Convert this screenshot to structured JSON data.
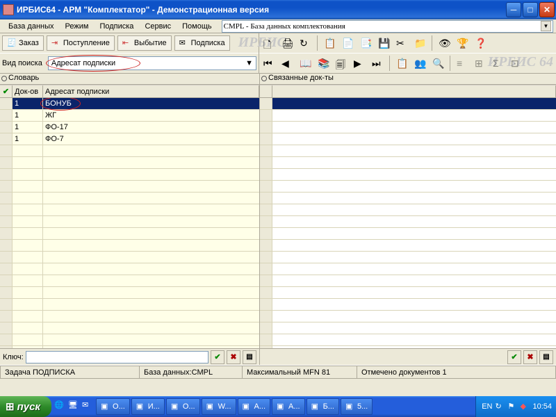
{
  "window": {
    "title": "ИРБИС64 - АРМ \"Комплектатор\" - Демонстрационная версия"
  },
  "menu": {
    "items": [
      "База данных",
      "Режим",
      "Подписка",
      "Сервис",
      "Помощь"
    ]
  },
  "db_selector": {
    "value": "CMPL - База данных комплектования"
  },
  "tabs": {
    "order_label": "Заказ",
    "receipt_label": "Поступление",
    "disposal_label": "Выбытие",
    "subscription_label": "Подписка"
  },
  "watermark": "ИРБИС 64",
  "search": {
    "label": "Вид поиска",
    "value": "Адресат подписки"
  },
  "left_pane": {
    "title": "Словарь",
    "columns": {
      "mark": "✔",
      "docov": "Док-ов",
      "addr": "Адресат подписки"
    },
    "rows": [
      {
        "docov": "1",
        "addr": "БОНУБ",
        "selected": true,
        "circled": true
      },
      {
        "docov": "1",
        "addr": "ЖГ"
      },
      {
        "docov": "1",
        "addr": "ФО-17"
      },
      {
        "docov": "1",
        "addr": "ФО-7"
      }
    ],
    "empty_rows": 18,
    "key_label": "Ключ:",
    "key_value": ""
  },
  "right_pane": {
    "title": "Связанные док-ты",
    "empty_rows": 22
  },
  "statusbar": {
    "task": "Задача ПОДПИСКА",
    "db": "База данных:CMPL",
    "maxmfn": "Максимальный MFN 81",
    "marked": "Отмечено документов 1"
  },
  "taskbar": {
    "start": "пуск",
    "buttons": [
      "O...",
      "И...",
      "О...",
      "W...",
      "А...",
      "А...",
      "Б...",
      "5..."
    ],
    "lang": "EN",
    "clock": "10:54"
  }
}
